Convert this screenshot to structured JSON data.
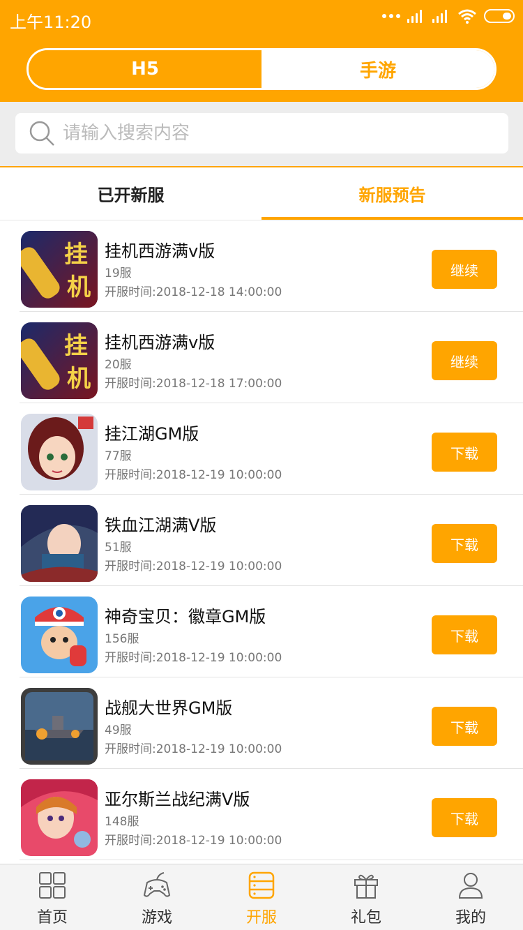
{
  "status_bar": {
    "time": "上午11:20"
  },
  "segment": {
    "left": "H5",
    "right": "手游"
  },
  "search": {
    "placeholder": "请输入搜索内容"
  },
  "tabs": [
    "已开新服",
    "新服预告"
  ],
  "games": [
    {
      "name": "挂机西游满v版",
      "server": "19服",
      "time": "开服时间:2018-12-18 14:00:00",
      "button": "继续",
      "icon": "game-icon-guaji"
    },
    {
      "name": "挂机西游满v版",
      "server": "20服",
      "time": "开服时间:2018-12-18 17:00:00",
      "button": "继续",
      "icon": "game-icon-guaji"
    },
    {
      "name": "挂江湖GM版",
      "server": "77服",
      "time": "开服时间:2018-12-19 10:00:00",
      "button": "下载",
      "icon": "game-icon-jianghu"
    },
    {
      "name": "铁血江湖满V版",
      "server": "51服",
      "time": "开服时间:2018-12-19 10:00:00",
      "button": "下载",
      "icon": "game-icon-tiexue"
    },
    {
      "name": "神奇宝贝：徽章GM版",
      "server": "156服",
      "time": "开服时间:2018-12-19 10:00:00",
      "button": "下载",
      "icon": "game-icon-pokemon"
    },
    {
      "name": "战舰大世界GM版",
      "server": "49服",
      "time": "开服时间:2018-12-19 10:00:00",
      "button": "下载",
      "icon": "game-icon-warship"
    },
    {
      "name": "亚尔斯兰战纪满V版",
      "server": "148服",
      "time": "开服时间:2018-12-19 10:00:00",
      "button": "下载",
      "icon": "game-icon-arslan"
    }
  ],
  "bottom_nav": [
    {
      "label": "首页",
      "icon": "home-icon"
    },
    {
      "label": "游戏",
      "icon": "gamepad-icon"
    },
    {
      "label": "开服",
      "icon": "server-icon"
    },
    {
      "label": "礼包",
      "icon": "gift-icon"
    },
    {
      "label": "我的",
      "icon": "user-icon"
    }
  ],
  "colors": {
    "accent": "#FFA500",
    "text": "#111111",
    "muted": "#777777"
  }
}
